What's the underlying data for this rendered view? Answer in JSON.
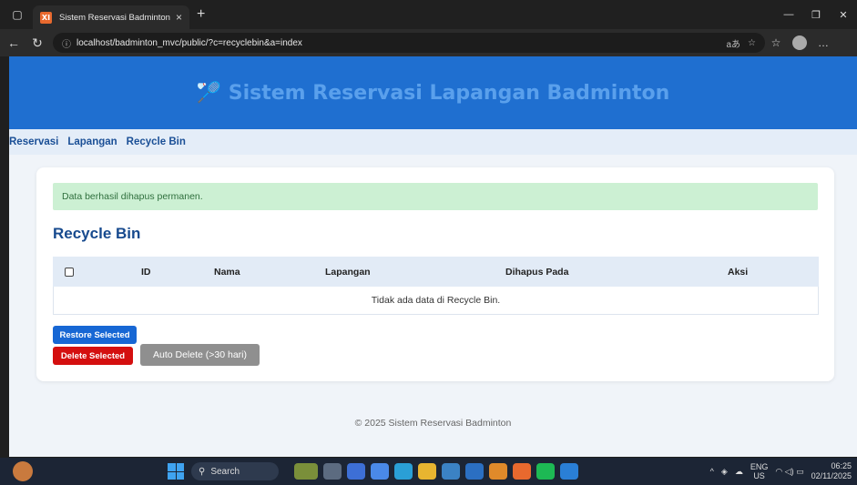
{
  "browser": {
    "tab_title": "Sistem Reservasi Badminton",
    "tab_favicon": "XI",
    "url": "localhost/badminton_mvc/public/?c=recyclebin&a=index",
    "url_right": "aあ"
  },
  "header": {
    "icon": "🏸",
    "title": "Sistem Reservasi Lapangan Badminton"
  },
  "nav": {
    "items": [
      "Reservasi",
      "Lapangan",
      "Recycle Bin"
    ]
  },
  "alert": "Data berhasil dihapus permanen.",
  "section_title": "Recycle Bin",
  "table": {
    "columns": [
      "ID",
      "Nama",
      "Lapangan",
      "Dihapus Pada",
      "Aksi"
    ],
    "empty_message": "Tidak ada data di Recycle Bin."
  },
  "buttons": {
    "restore": "Restore Selected",
    "delete": "Delete Selected",
    "auto_delete": "Auto Delete (>30 hari)"
  },
  "footer": "© 2025 Sistem Reservasi Badminton",
  "taskbar": {
    "search_label": "Search",
    "lang_top": "ENG",
    "lang_bottom": "US",
    "time": "06:25",
    "date": "02/11/2025"
  },
  "colors": {
    "header_bg": "#1f6fd0",
    "title_color": "#5aa0ec",
    "restore_bg": "#1767d4",
    "delete_bg": "#d40f0f",
    "auto_bg": "#8f8f8f",
    "alert_bg": "#ccf0d3"
  }
}
